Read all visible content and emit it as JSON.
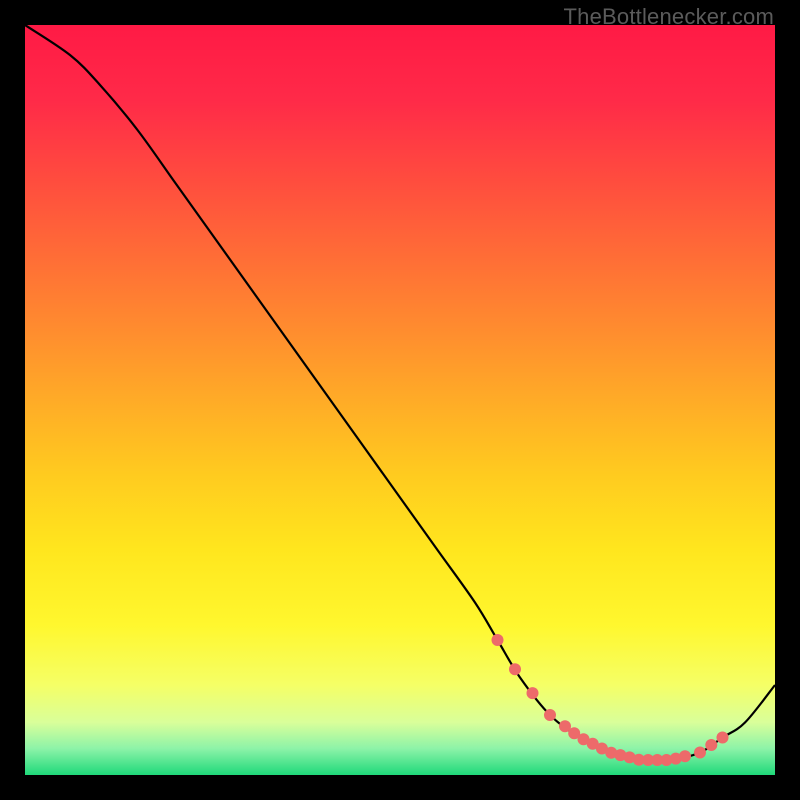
{
  "attribution": "TheBottlenecker.com",
  "chart_data": {
    "type": "line",
    "title": "",
    "xlabel": "",
    "ylabel": "",
    "xlim": [
      0,
      100
    ],
    "ylim": [
      0,
      100
    ],
    "x": [
      0,
      6,
      10,
      15,
      20,
      25,
      30,
      35,
      40,
      45,
      50,
      55,
      60,
      63,
      66,
      70,
      74,
      78,
      82,
      86,
      90,
      93,
      96,
      100
    ],
    "values": [
      100,
      96,
      92,
      86,
      79,
      72,
      65,
      58,
      51,
      44,
      37,
      30,
      23,
      18,
      13,
      8,
      5,
      3,
      2,
      2,
      3,
      5,
      7,
      12
    ],
    "marker_clusters": [
      {
        "x_start": 63,
        "x_end": 70,
        "count": 4
      },
      {
        "x_start": 72,
        "x_end": 88,
        "count": 14
      },
      {
        "x_start": 90,
        "x_end": 93,
        "count": 3
      }
    ],
    "marker_color": "#ed6a6a",
    "background_gradient": {
      "stops": [
        {
          "offset": 0.0,
          "color": "#ff1a45"
        },
        {
          "offset": 0.1,
          "color": "#ff2a48"
        },
        {
          "offset": 0.2,
          "color": "#ff4a3f"
        },
        {
          "offset": 0.3,
          "color": "#ff6a37"
        },
        {
          "offset": 0.4,
          "color": "#ff8a2f"
        },
        {
          "offset": 0.5,
          "color": "#ffab27"
        },
        {
          "offset": 0.6,
          "color": "#ffcb1f"
        },
        {
          "offset": 0.7,
          "color": "#ffe61e"
        },
        {
          "offset": 0.8,
          "color": "#fff72e"
        },
        {
          "offset": 0.88,
          "color": "#f5ff66"
        },
        {
          "offset": 0.93,
          "color": "#d9ff9a"
        },
        {
          "offset": 0.965,
          "color": "#8cf3a8"
        },
        {
          "offset": 1.0,
          "color": "#1fd97a"
        }
      ]
    }
  }
}
